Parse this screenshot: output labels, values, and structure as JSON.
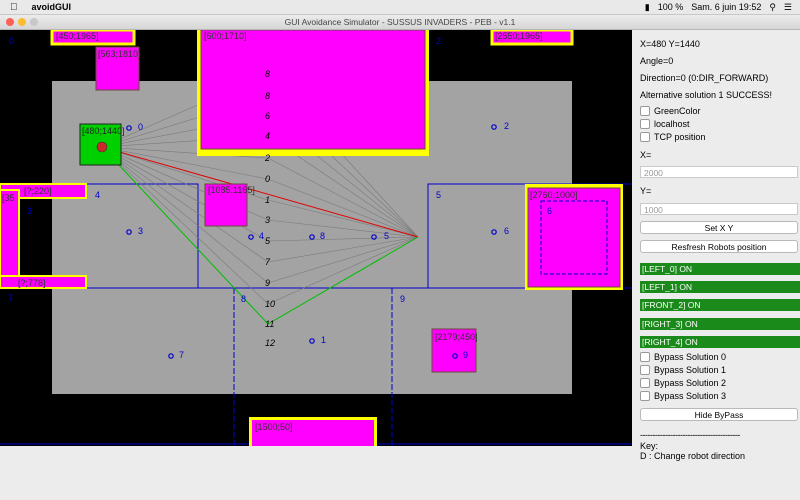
{
  "menubar": {
    "app_name": "avoidGUI",
    "battery": "100 %",
    "clock": "Sam. 6 juin  19:52"
  },
  "window": {
    "title": "GUI Avoidance Simulator - SUSSUS INVADERS - PEB - v1.1"
  },
  "panel": {
    "position_text": "X=480 Y=1440",
    "angle_text": "Angle=0",
    "direction_text": "Direction=0 (0:DIR_FORWARD)",
    "solution_text": "Alternative solution 1 SUCCESS!",
    "options": [
      "GreenColor",
      "localhost",
      "TCP position"
    ],
    "x_label": "X=",
    "x_placeholder": "2000",
    "y_label": "Y=",
    "y_placeholder": "1000",
    "set_button": "Set X  Y",
    "refresh_button": "Resfresh Robots position",
    "sensors": [
      "[LEFT_0] ON",
      "[LEFT_1] ON",
      "[FRONT_2] ON",
      "[RIGHT_3] ON",
      "[RIGHT_4] ON"
    ],
    "bypass": [
      "Bypass Solution 0",
      "Bypass Solution 1",
      "Bypass Solution 2",
      "Bypass Solution 3"
    ],
    "hide_button": "Hide ByPass",
    "separator": "----------------------------------------",
    "key_title": "Key:",
    "key_line": "D : Change robot direction"
  },
  "canvas": {
    "colors": {
      "field": "#a3a3a3",
      "obstacle": "#ff00ff",
      "highlight": "#ffff00",
      "robot": "#00d000",
      "zone_line": "#0000cc"
    },
    "obstacles": [
      "[450;1965]",
      "[563;1810]",
      "[600;1710]",
      "[2550;1965]",
      "[480;1440]",
      "[1085;1165]",
      "[2760;1000]",
      "[2179;450]",
      "[1500;50]",
      "[?;220]",
      "[35",
      "[?;778]"
    ],
    "zone_labels": [
      "0",
      "1",
      "2",
      "3",
      "4",
      "5",
      "6",
      "7",
      "8",
      "9"
    ],
    "probe_labels": [
      "8",
      "8",
      "6",
      "4",
      "2",
      "0",
      "1",
      "3",
      "5",
      "7",
      "9",
      "10",
      "11",
      "12",
      "13"
    ]
  }
}
